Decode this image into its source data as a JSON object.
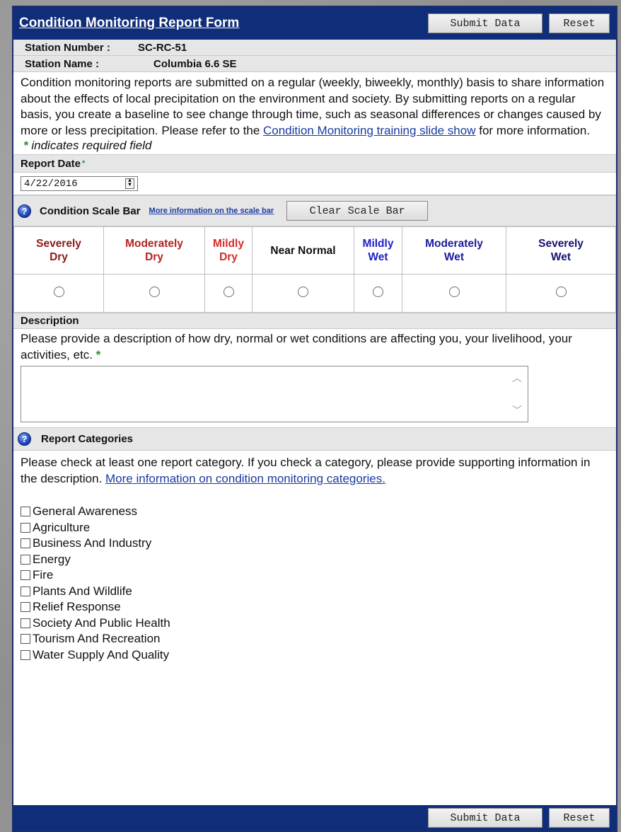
{
  "header": {
    "title": "Condition Monitoring Report Form",
    "submit_label": "Submit Data",
    "reset_label": "Reset"
  },
  "station": {
    "number_label": "Station Number :",
    "number_value": "SC-RC-51",
    "name_label": "Station Name :",
    "name_value": "Columbia 6.6 SE"
  },
  "intro": {
    "text": "Condition monitoring reports are submitted on a regular (weekly, biweekly, monthly) basis to share information about the effects of local precipitation on the environment and society. By submitting reports on a regular basis, you create a baseline to see change through time, such as seasonal differences or changes caused by more or less precipitation. Please refer to the ",
    "link_text": "Condition Monitoring training slide show",
    "suffix": " for more information.",
    "required_star": "*",
    "required_note": "indicates required field"
  },
  "report_date": {
    "label": "Report Date",
    "star": "*",
    "value": "4/22/2016"
  },
  "scale_bar": {
    "title": "Condition Scale Bar",
    "info_link": "More information on the scale bar",
    "clear_label": "Clear Scale Bar",
    "options": [
      {
        "label_line1": "Severely",
        "label_line2": "Dry",
        "color": "#8b1a1a"
      },
      {
        "label_line1": "Moderately",
        "label_line2": "Dry",
        "color": "#b22222"
      },
      {
        "label_line1": "Mildly",
        "label_line2": "Dry",
        "color": "#d42a2a"
      },
      {
        "label_line1": "Near Normal",
        "label_line2": "",
        "color": "#111111"
      },
      {
        "label_line1": "Mildly",
        "label_line2": "Wet",
        "color": "#2020c8"
      },
      {
        "label_line1": "Moderately",
        "label_line2": "Wet",
        "color": "#1c1c9a"
      },
      {
        "label_line1": "Severely",
        "label_line2": "Wet",
        "color": "#141470"
      }
    ]
  },
  "description": {
    "label": "Description",
    "prompt": "Please provide a description of how dry, normal or wet conditions are affecting you, your livelihood, your activities, etc.",
    "star": "*",
    "value": ""
  },
  "categories": {
    "title": "Report Categories",
    "text": "Please check at least one report category. If you check a category, please provide supporting information in the description. ",
    "link_text": "More information on condition monitoring categories.",
    "items": [
      "General Awareness",
      "Agriculture",
      "Business And Industry",
      "Energy",
      "Fire",
      "Plants And Wildlife",
      "Relief Response",
      "Society And Public Health",
      "Tourism And Recreation",
      "Water Supply And Quality"
    ]
  },
  "footer": {
    "submit_label": "Submit Data",
    "reset_label": "Reset"
  },
  "colors": {
    "header_bg": "#0f2d78",
    "bar_bg": "#e6e6e6",
    "link": "#1a3aa0",
    "required": "#2f8f2f"
  }
}
